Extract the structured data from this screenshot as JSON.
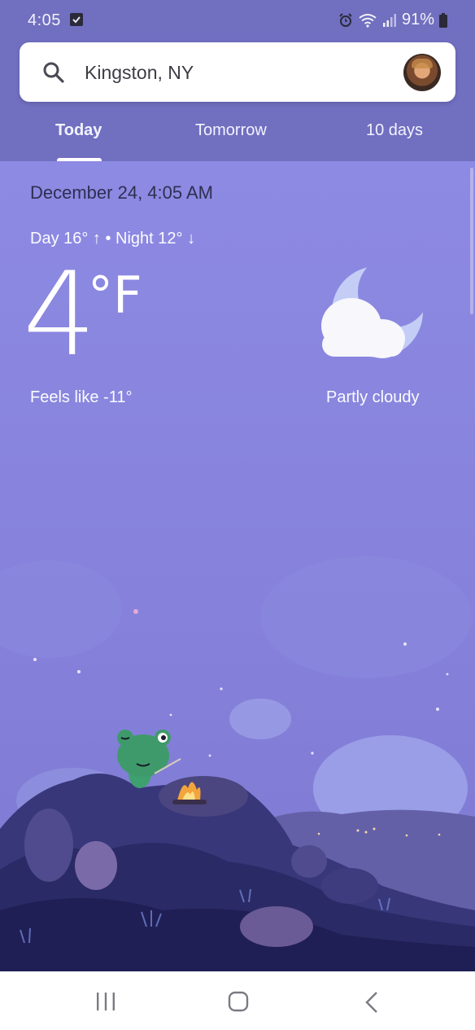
{
  "status_bar": {
    "time": "4:05",
    "battery": "91%"
  },
  "search": {
    "location": "Kingston, NY"
  },
  "tabs": [
    {
      "label": "Today",
      "selected": true
    },
    {
      "label": "Tomorrow",
      "selected": false
    },
    {
      "label": "10 days",
      "selected": false
    }
  ],
  "weather": {
    "date_time": "December 24, 4:05 AM",
    "day_night": "Day 16° ↑ • Night 12° ↓",
    "temperature": "4",
    "unit": "°F",
    "feels_like": "Feels like -11°",
    "condition": "Partly cloudy",
    "condition_icon": "partly-cloudy-night-icon"
  },
  "colors": {
    "header_bg": "#716fc0",
    "sky": "#8784df",
    "date_text": "#2f2f52",
    "nav_bg": "#ffffff"
  },
  "nav": {
    "icons": [
      "recents-icon",
      "home-icon",
      "back-icon"
    ]
  }
}
